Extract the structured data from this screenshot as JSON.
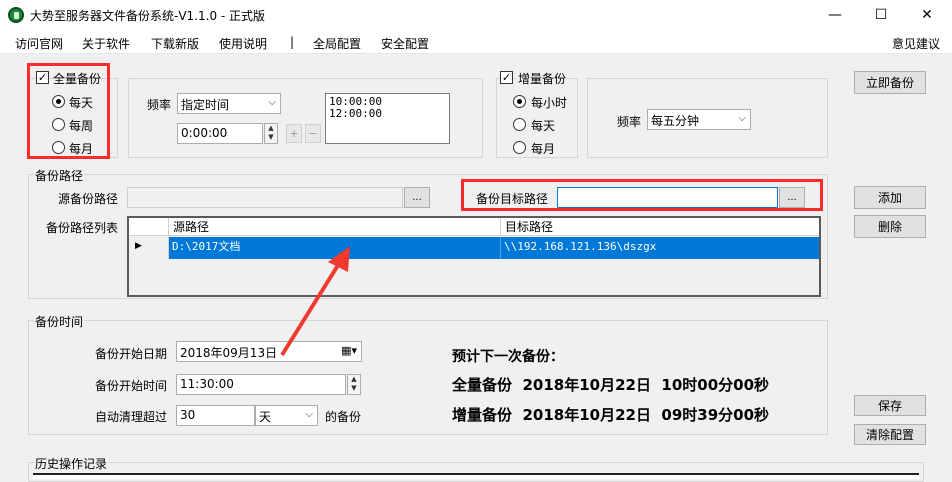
{
  "window": {
    "title": "大势至服务器文件备份系统-V1.1.0 - 正式版",
    "min_glyph": "—",
    "max_glyph": "☐",
    "close_glyph": "✕"
  },
  "menu": {
    "items": [
      "访问官网",
      "关于软件",
      "下载新版",
      "使用说明",
      "|",
      "全局配置",
      "安全配置"
    ],
    "feedback": "意见建议"
  },
  "full_backup": {
    "checkbox_label": "全量备份",
    "checked": true,
    "options": [
      "每天",
      "每周",
      "每月"
    ],
    "selected": "每天",
    "freq_label": "频率",
    "freq_value": "指定时间",
    "time_value": "0:00:00",
    "plus": "+",
    "minus": "−",
    "times_list": [
      "10:00:00",
      "12:00:00"
    ]
  },
  "incr_backup": {
    "checkbox_label": "增量备份",
    "checked": true,
    "options": [
      "每小时",
      "每天",
      "每月"
    ],
    "selected": "每小时",
    "freq_label": "频率",
    "freq_value": "每五分钟"
  },
  "buttons": {
    "backup_now": "立即备份",
    "add": "添加",
    "delete": "删除",
    "save": "保存",
    "clear_config": "清除配置",
    "browse": "..."
  },
  "paths": {
    "group_label": "备份路径",
    "source_label": "源备份路径",
    "source_value": "",
    "target_label": "备份目标路径",
    "target_value": "",
    "list_label": "备份路径列表",
    "columns": [
      "源路径",
      "目标路径"
    ],
    "rows": [
      {
        "source": "D:\\2017文档",
        "target": "\\\\192.168.121.136\\dszgx"
      }
    ]
  },
  "schedule": {
    "group_label": "备份时间",
    "start_date_label": "备份开始日期",
    "start_date_value": "2018年09月13日",
    "start_time_label": "备份开始时间",
    "start_time_value": "11:30:00",
    "auto_clean_label": "自动清理超过",
    "auto_clean_value": "30",
    "auto_clean_unit": "天",
    "auto_clean_suffix": "的备份",
    "next_label": "预计下一次备份：",
    "full_line": "全量备份  2018年10月22日  10时00分00秒",
    "incr_line": "增量备份  2018年10月22日  09时39分00秒"
  },
  "history": {
    "group_label": "历史操作记录"
  },
  "colors": {
    "highlight_red": "#ff2a2a",
    "selection_blue": "#0078d7",
    "arrow_red": "#f03a2e"
  }
}
